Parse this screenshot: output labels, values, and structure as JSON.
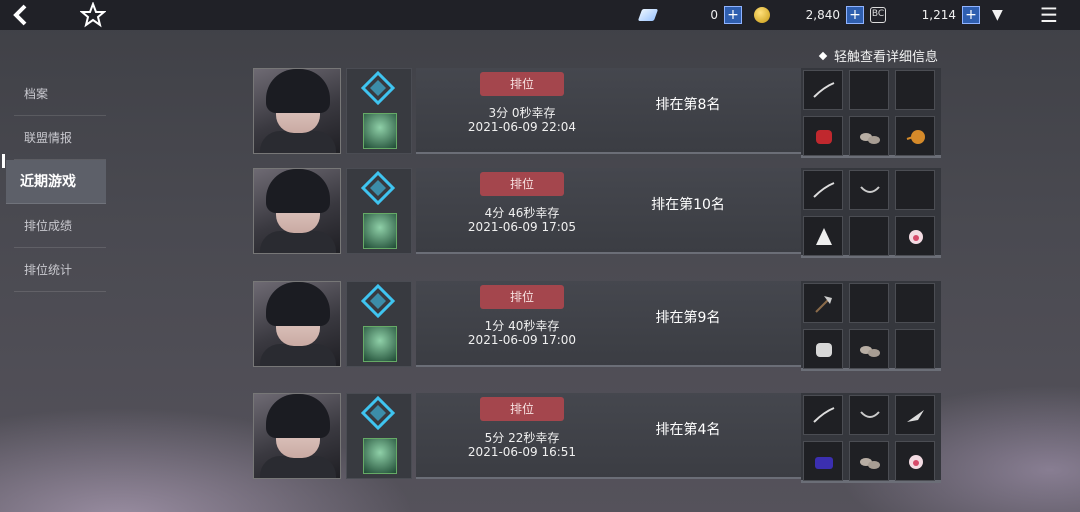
{
  "topbar": {
    "back_icon": "back-arrow-icon",
    "favorite_icon": "star-icon",
    "gem_amount": "0",
    "coin_amount": "2,840",
    "token_amount": "1,214",
    "plus": "+",
    "gem_icon": "crystal-icon",
    "coin_icon": "coin-icon",
    "token_icon": "token-icon",
    "token_glyph": "BC",
    "dropdown_icon": "▼",
    "menu_icon": "☰"
  },
  "hint": "轻触查看详细信息",
  "sidebar": {
    "items": [
      {
        "label": "档案"
      },
      {
        "label": "联盟情报"
      },
      {
        "label": "近期游戏"
      },
      {
        "label": "排位成绩"
      },
      {
        "label": "排位统计"
      }
    ],
    "active_index": 2
  },
  "matches": [
    {
      "mode": "排位",
      "survival": "3分 0秒幸存",
      "date": "2021-06-09 22:04",
      "placement": "排在第8名",
      "items": [
        "blade",
        "empty",
        "empty",
        "red-armor",
        "shoes",
        "orange-trinket"
      ]
    },
    {
      "mode": "排位",
      "survival": "4分 46秒幸存",
      "date": "2021-06-09 17:05",
      "placement": "排在第10名",
      "items": [
        "blade",
        "ring",
        "empty",
        "white-pouch",
        "empty",
        "pink-pearl"
      ]
    },
    {
      "mode": "排位",
      "survival": "1分 40秒幸存",
      "date": "2021-06-09 17:00",
      "placement": "排在第9名",
      "items": [
        "axe",
        "empty",
        "empty",
        "silver-armor",
        "shoes",
        "empty"
      ]
    },
    {
      "mode": "排位",
      "survival": "5分 22秒幸存",
      "date": "2021-06-09 16:51",
      "placement": "排在第4名",
      "items": [
        "blade",
        "ring",
        "feather",
        "blue-armor",
        "shoes",
        "pink-pearl"
      ]
    }
  ],
  "colors": {
    "rank_button": "#a4464d",
    "plus_button": "#2f5fb0",
    "rank_icon": "#3fc4f0"
  }
}
